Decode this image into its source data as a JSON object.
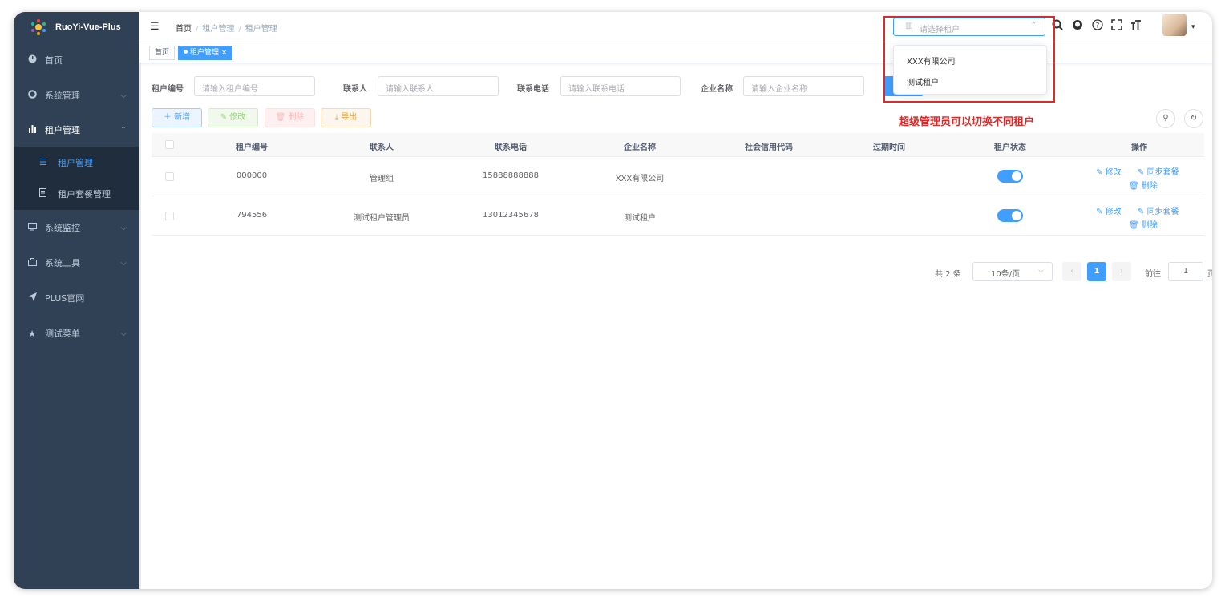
{
  "app": {
    "title": "RuoYi-Vue-Plus"
  },
  "sidebar": {
    "items": [
      {
        "label": "首页",
        "icon": "dashboard-icon"
      },
      {
        "label": "系统管理",
        "icon": "gear-icon"
      },
      {
        "label": "租户管理",
        "icon": "chart-icon"
      },
      {
        "label": "系统监控",
        "icon": "monitor-icon"
      },
      {
        "label": "系统工具",
        "icon": "toolbox-icon"
      },
      {
        "label": "PLUS官网",
        "icon": "send-icon"
      },
      {
        "label": "测试菜单",
        "icon": "star-icon"
      }
    ],
    "subitems": [
      {
        "label": "租户管理",
        "icon": "list-icon",
        "active": true
      },
      {
        "label": "租户套餐管理",
        "icon": "package-icon"
      }
    ]
  },
  "navbar": {
    "breadcrumb": [
      "首页",
      "租户管理",
      "租户管理"
    ],
    "tenant_placeholder": "请选择租户"
  },
  "tags": [
    {
      "label": "首页"
    },
    {
      "label": "租户管理",
      "close": "×",
      "active": true
    }
  ],
  "tenant_dropdown": {
    "options": [
      "XXX有限公司",
      "测试租户"
    ]
  },
  "annotation": "超级管理员可以切换不同租户",
  "search": {
    "fields": [
      {
        "label": "租户编号",
        "placeholder": "请输入租户编号"
      },
      {
        "label": "联系人",
        "placeholder": "请输入联系人"
      },
      {
        "label": "联系电话",
        "placeholder": "请输入联系电话"
      },
      {
        "label": "企业名称",
        "placeholder": "请输入企业名称"
      }
    ]
  },
  "toolbar": {
    "add": "新增",
    "edit": "修改",
    "delete": "删除",
    "export": "导出"
  },
  "table": {
    "columns": [
      "租户编号",
      "联系人",
      "联系电话",
      "企业名称",
      "社会信用代码",
      "过期时间",
      "租户状态",
      "操作"
    ],
    "rows": [
      {
        "tenant_id": "000000",
        "contact": "管理组",
        "phone": "15888888888",
        "company": "XXX有限公司",
        "credit_code": "",
        "expire": "",
        "status_on": true
      },
      {
        "tenant_id": "794556",
        "contact": "测试租户管理员",
        "phone": "13012345678",
        "company": "测试租户",
        "credit_code": "",
        "expire": "",
        "status_on": true
      }
    ],
    "actions": {
      "edit": "修改",
      "sync": "同步套餐",
      "delete": "删除"
    }
  },
  "pagination": {
    "total": "共 2 条",
    "page_size": "10条/页",
    "current": "1",
    "jump_label": "前往",
    "jump_value": "1",
    "suffix": "页"
  },
  "colors": {
    "primary": "#409eff",
    "sidebar_bg": "#304156",
    "annotation": "#d92b2b"
  }
}
